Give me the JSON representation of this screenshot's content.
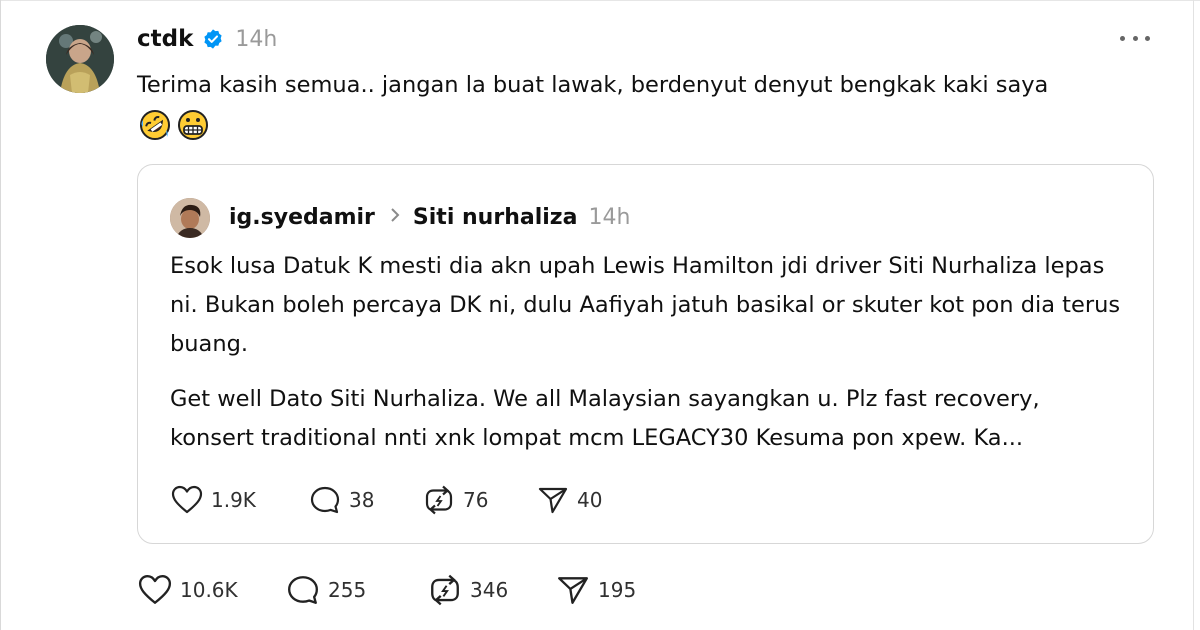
{
  "post": {
    "username": "ctdk",
    "timestamp": "14h",
    "text": "Terima kasih semua.. jangan la buat lawak, berdenyut denyut bengkak kaki saya",
    "emojis": [
      "rolling-on-floor-laughing",
      "grimacing-face"
    ],
    "metrics": {
      "likes": "10.6K",
      "replies": "255",
      "reposts": "346",
      "shares": "195"
    }
  },
  "quote": {
    "username": "ig.syedamir",
    "reply_target": "Siti nurhaliza",
    "timestamp": "14h",
    "paragraph1": "Esok lusa Datuk K mesti dia akn upah Lewis Hamilton jdi driver Siti Nurhaliza lepas ni. Bukan boleh percaya DK ni, dulu Aafiyah jatuh basikal or skuter kot pon dia terus buang.",
    "paragraph2": "Get well Dato Siti Nurhaliza. We all Malaysian sayangkan u. Plz fast recovery, konsert traditional nnti xnk lompat mcm LEGACY30 Kesuma pon xpew. Ka...",
    "metrics": {
      "likes": "1.9K",
      "replies": "38",
      "reposts": "76",
      "shares": "40"
    }
  },
  "icons": {
    "verified": "verified-badge-icon",
    "more": "more-options-icon",
    "like": "heart-icon",
    "reply": "comment-bubble-icon",
    "repost": "repost-arrows-icon",
    "share": "send-paper-plane-icon",
    "reply_arrow": "chevron-right-icon"
  },
  "colors": {
    "verified_blue": "#0095f6",
    "muted_text": "#9a9a9a",
    "border": "#d7d7d7"
  }
}
